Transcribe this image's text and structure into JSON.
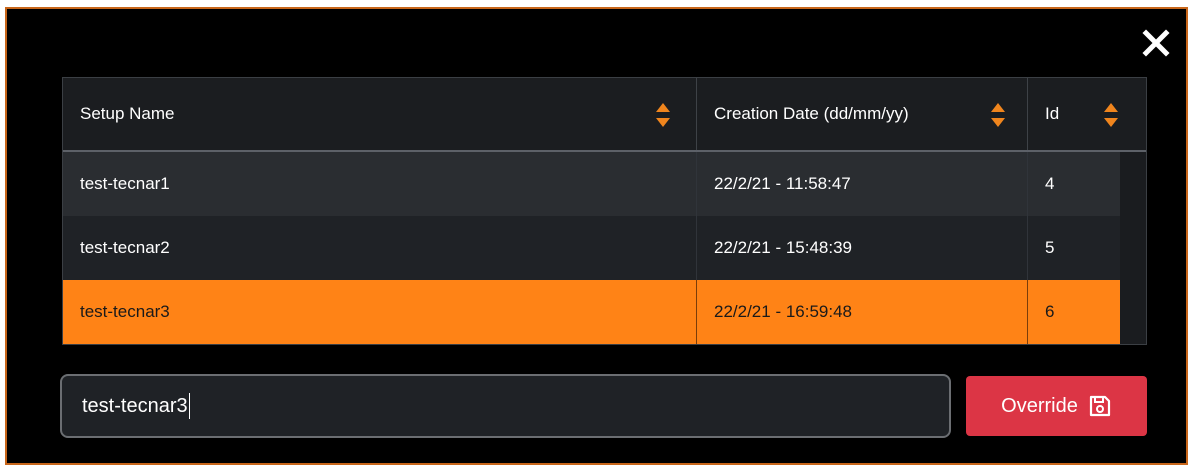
{
  "table": {
    "columns": [
      {
        "label": "Setup Name"
      },
      {
        "label": "Creation Date (dd/mm/yy)"
      },
      {
        "label": "Id"
      }
    ],
    "rows": [
      {
        "name": "test-tecnar1",
        "date": "22/2/21 - 11:58:47",
        "id": "4",
        "selected": false
      },
      {
        "name": "test-tecnar2",
        "date": "22/2/21 - 15:48:39",
        "id": "5",
        "selected": false
      },
      {
        "name": "test-tecnar3",
        "date": "22/2/21 - 16:59:48",
        "id": "6",
        "selected": true
      }
    ]
  },
  "input": {
    "value": "test-tecnar3"
  },
  "override_button": {
    "label": "Override",
    "icon": "save-icon"
  },
  "close_button": {
    "icon": "close-icon"
  },
  "colors": {
    "accent": "#ff8316",
    "sort_icon": "#f0851d",
    "button": "#dc3545",
    "row_even": "#2a2d31",
    "row_odd": "#1f2226",
    "modal_border": "#c8661a"
  }
}
